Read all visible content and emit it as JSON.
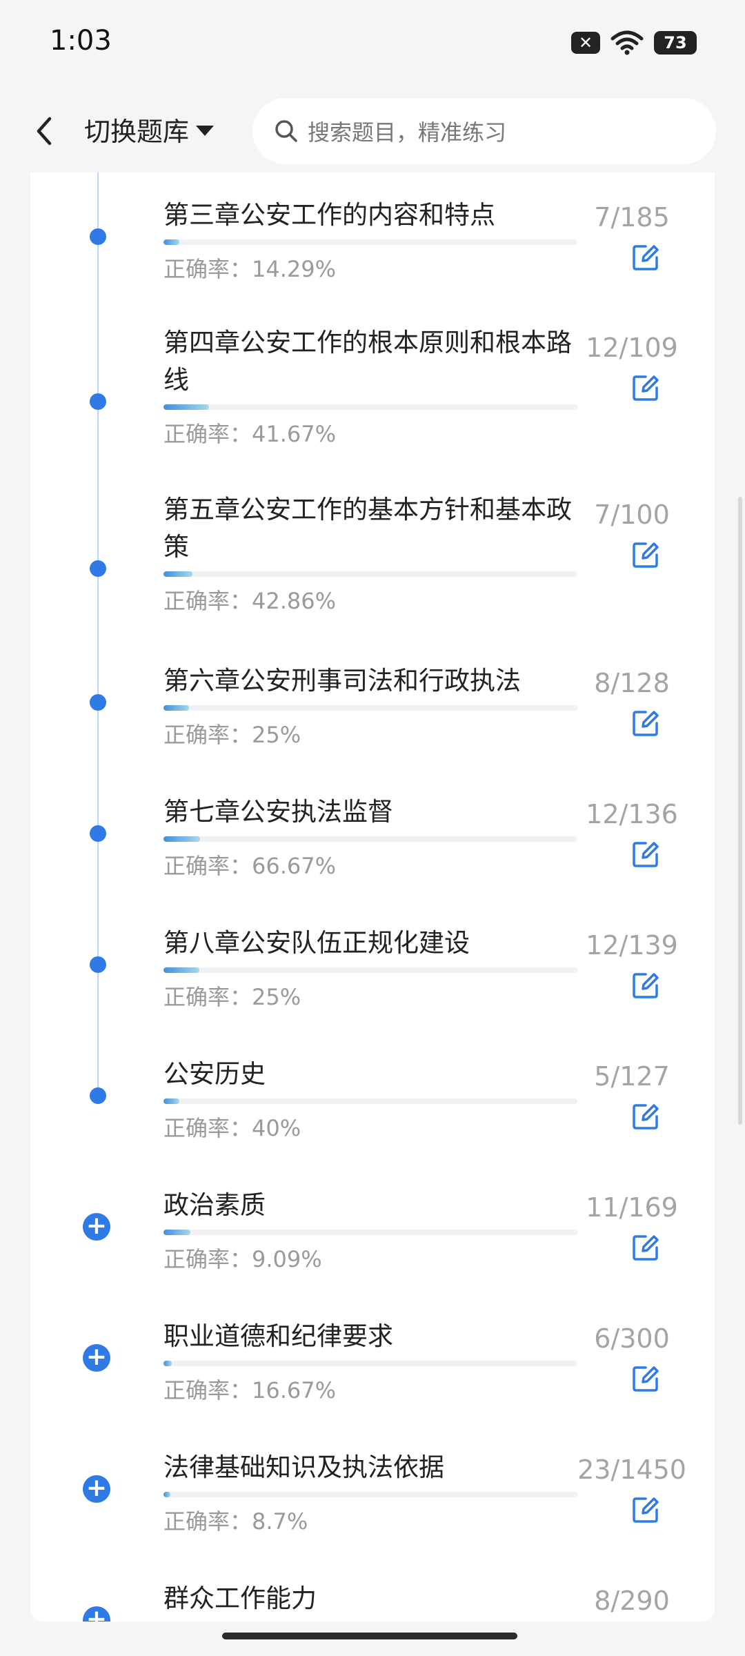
{
  "status": {
    "time": "1:03",
    "battery": "73"
  },
  "header": {
    "switch_label": "切换题库",
    "search_placeholder": "搜索题目，精准练习"
  },
  "chapters": [
    {
      "title": "第三章公安工作的内容和特点",
      "accuracy": "正确率：14.29%",
      "count": "7/185",
      "progress": 0.038,
      "marker": "dot"
    },
    {
      "title": "第四章公安工作的根本原则和根本路线",
      "accuracy": "正确率：41.67%",
      "count": "12/109",
      "progress": 0.11,
      "marker": "dot"
    },
    {
      "title": "第五章公安工作的基本方针和基本政策",
      "accuracy": "正确率：42.86%",
      "count": "7/100",
      "progress": 0.07,
      "marker": "dot"
    },
    {
      "title": "第六章公安刑事司法和行政执法",
      "accuracy": "正确率：25%",
      "count": "8/128",
      "progress": 0.062,
      "marker": "dot"
    },
    {
      "title": "第七章公安执法监督",
      "accuracy": "正确率：66.67%",
      "count": "12/136",
      "progress": 0.088,
      "marker": "dot"
    },
    {
      "title": "第八章公安队伍正规化建设",
      "accuracy": "正确率：25%",
      "count": "12/139",
      "progress": 0.086,
      "marker": "dot"
    },
    {
      "title": "公安历史",
      "accuracy": "正确率：40%",
      "count": "5/127",
      "progress": 0.039,
      "marker": "dot"
    },
    {
      "title": "政治素质",
      "accuracy": "正确率：9.09%",
      "count": "11/169",
      "progress": 0.065,
      "marker": "plus"
    },
    {
      "title": "职业道德和纪律要求",
      "accuracy": "正确率：16.67%",
      "count": "6/300",
      "progress": 0.02,
      "marker": "plus"
    },
    {
      "title": "法律基础知识及执法依据",
      "accuracy": "正确率：8.7%",
      "count": "23/1450",
      "progress": 0.016,
      "marker": "plus"
    },
    {
      "title": "群众工作能力",
      "accuracy": "",
      "count": "8/290",
      "progress": 0.028,
      "marker": "plus"
    }
  ],
  "colors": {
    "accent": "#2e7be6",
    "progress_start": "#3c8fe0",
    "progress_end": "#a8d8e8"
  }
}
